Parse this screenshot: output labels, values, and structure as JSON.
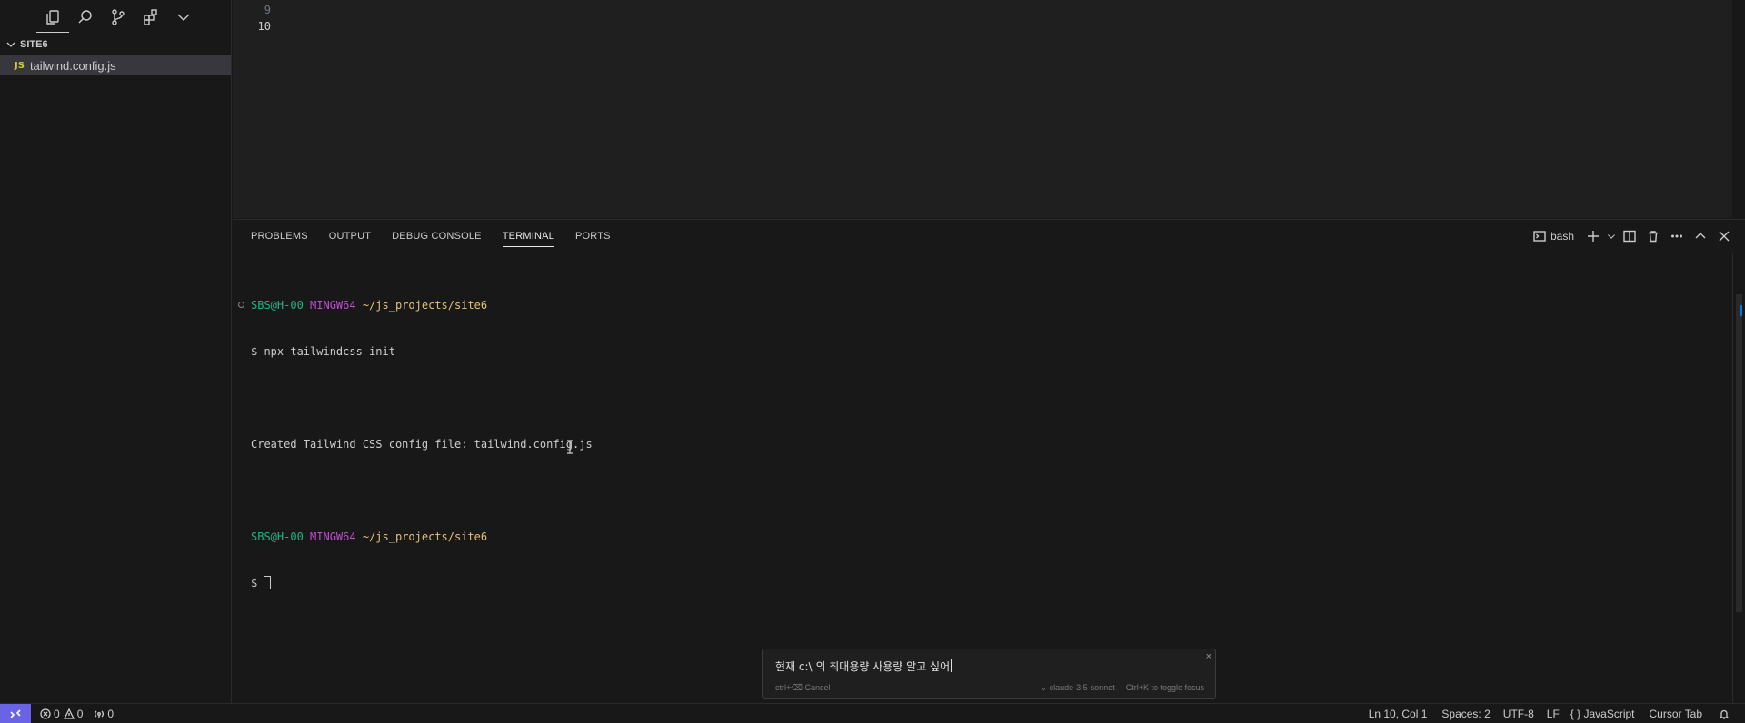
{
  "sidebar": {
    "activity": [
      "explorer-icon",
      "search-icon",
      "source-control-icon",
      "extensions-icon",
      "chevron-down-icon"
    ],
    "folder_name": "SITE6",
    "files": [
      {
        "badge": "JS",
        "name": "tailwind.config.js"
      }
    ]
  },
  "editor": {
    "line_numbers": [
      "9",
      "10"
    ]
  },
  "panel": {
    "tabs": [
      "PROBLEMS",
      "OUTPUT",
      "DEBUG CONSOLE",
      "TERMINAL",
      "PORTS"
    ],
    "active_tab": "TERMINAL",
    "shell_label": "bash"
  },
  "terminal": {
    "user": "SBS@H-00",
    "system": "MINGW64",
    "path": "~/js_projects/site6",
    "command_line": "$ npx tailwindcss init",
    "output_line": "Created Tailwind CSS config file: tailwind.config.js",
    "prompt_symbol": "$ "
  },
  "ai_prompt": {
    "text": "현재 c:\\ 의 최대용량 사용량 알고 싶어",
    "cancel_hint": "ctrl+⌫ Cancel",
    "dot": ".",
    "model": "⌄ claude-3.5-sonnet",
    "focus_hint": "Ctrl+K to toggle focus",
    "close": "×"
  },
  "status": {
    "errors": "0",
    "warnings": "0",
    "ports": "0",
    "position": "Ln 10, Col 1",
    "spaces": "Spaces: 2",
    "encoding": "UTF-8",
    "eol": "LF",
    "language": "{ } JavaScript",
    "cursor_tab": "Cursor Tab"
  },
  "colors": {
    "accent_remote": "#6b63e6",
    "terminal_user": "#23b387",
    "terminal_system": "#c14dd3",
    "terminal_path": "#e5c07b",
    "js_badge": "#cbcb41"
  }
}
